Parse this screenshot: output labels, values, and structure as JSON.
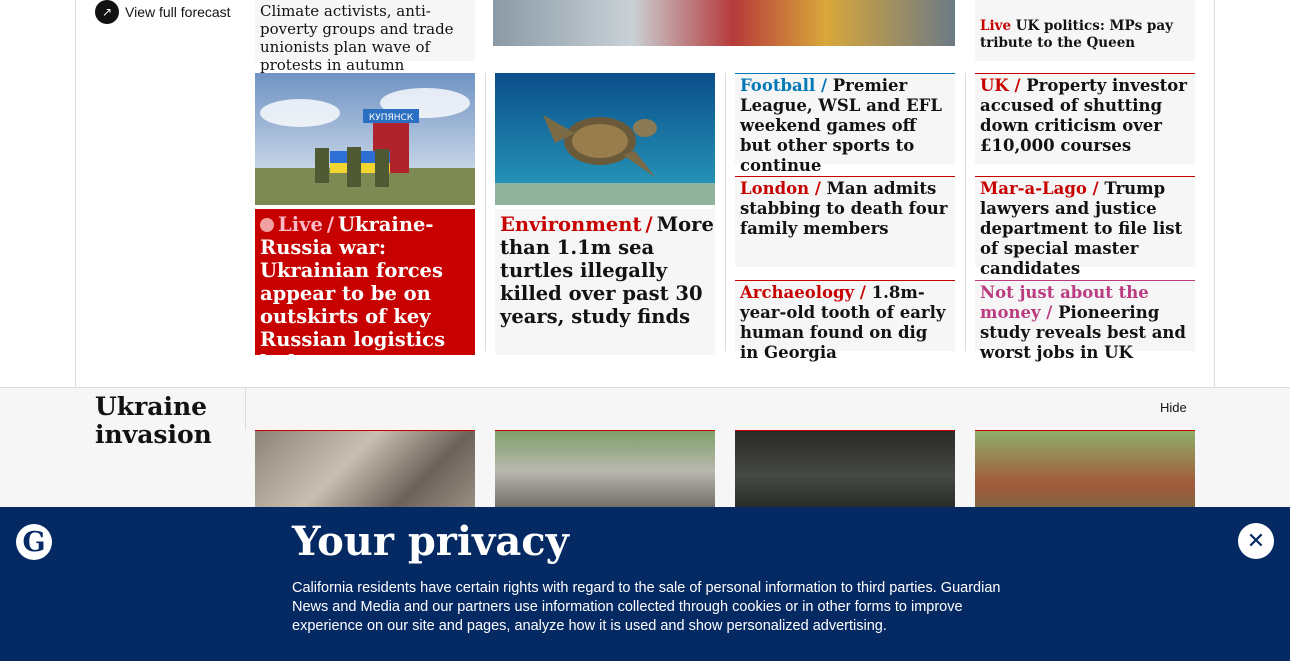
{
  "weather": {
    "forecast_label": "View full forecast",
    "icon": "external-link-icon"
  },
  "top_row": {
    "card1_text": "Climate activists, anti-poverty groups and trade unionists plan wave of protests in autumn",
    "card4_kicker": "Live",
    "card4_text": "UK politics: MPs pay tribute to the Queen"
  },
  "big_cards": [
    {
      "kicker": "Live",
      "separator": "/",
      "headline": "Ukraine-Russia war: Ukrainian forces appear to be on outskirts of key Russian logistics hub",
      "image_caption": "КУПЯНСК"
    },
    {
      "kicker": "Environment",
      "separator": "/",
      "headline": "More than 1.1m sea turtles illegally killed over past 30 years, study finds"
    }
  ],
  "small_cards": [
    {
      "kicker": "Football",
      "headline": "Premier League, WSL and EFL weekend games off but other sports to continue"
    },
    {
      "kicker": "UK",
      "headline": "Property investor accused of shutting down criticism over £10,000 courses"
    },
    {
      "kicker": "London",
      "headline": "Man admits stabbing to death four family members"
    },
    {
      "kicker": "Mar-a-Lago",
      "headline": "Trump lawyers and justice department to file list of special master candidates"
    },
    {
      "kicker": "Archaeology",
      "headline": "1.8m-year-old tooth of early human found on dig in Georgia"
    },
    {
      "kicker": "Not just about the money",
      "headline": "Pioneering study reveals best and worst jobs in UK"
    }
  ],
  "ukraine_section": {
    "title": "Ukraine invasion",
    "hide_label": "Hide"
  },
  "privacy": {
    "title": "Your privacy",
    "body": "California residents have certain rights with regard to the sale of personal information to third parties. Guardian News and Media and our partners use information collected through cookies or in other forms to improve experience on our site and pages, analyze how it is used and show personalized advertising.",
    "logo": "G",
    "close_icon": "close-icon"
  },
  "colors": {
    "news": "#c70000",
    "sport": "#0077b6",
    "lifestyle": "#bb3b80",
    "brand": "#052962"
  }
}
